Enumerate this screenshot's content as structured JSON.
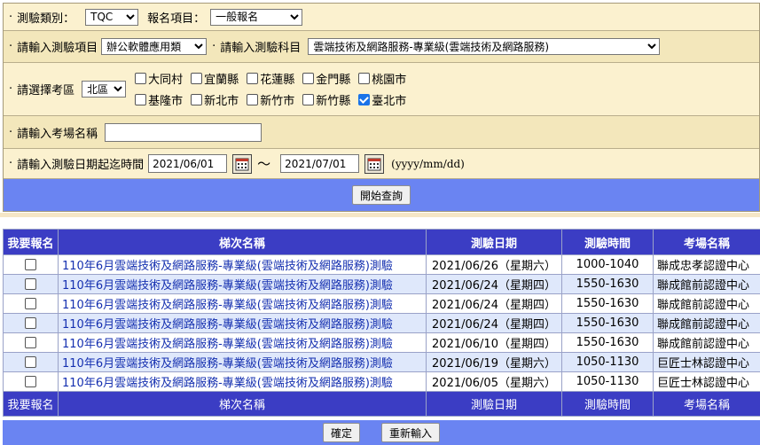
{
  "form": {
    "category_label": "測驗類別：",
    "category_value": "TQC",
    "reg_item_label": "報名項目：",
    "reg_item_value": "一般報名",
    "test_item_label": "請輸入測驗項目",
    "test_item_value": "辦公軟體應用類",
    "subject_label": "請輸入測驗科目",
    "subject_value": "雲端技術及網路服務-專業級(雲端技術及網路服務)",
    "area_label": "請選擇考區",
    "area_value": "北區",
    "areas_row1": [
      {
        "label": "大同村",
        "checked": false
      },
      {
        "label": "宜蘭縣",
        "checked": false
      },
      {
        "label": "花蓮縣",
        "checked": false
      },
      {
        "label": "金門縣",
        "checked": false
      },
      {
        "label": "桃園市",
        "checked": false
      }
    ],
    "areas_row2": [
      {
        "label": "基隆市",
        "checked": false
      },
      {
        "label": "新北市",
        "checked": false
      },
      {
        "label": "新竹市",
        "checked": false
      },
      {
        "label": "新竹縣",
        "checked": false
      },
      {
        "label": "臺北市",
        "checked": true
      }
    ],
    "venue_label": "請輸入考場名稱",
    "venue_value": "",
    "date_label": "請輸入測驗日期起迄時間",
    "date_from": "2021/06/01",
    "date_tilde": "～",
    "date_to": "2021/07/01",
    "date_format": "(yyyy/mm/dd)",
    "search_button": "開始查詢"
  },
  "table": {
    "headers": [
      "我要報名",
      "梯次名稱",
      "測驗日期",
      "測驗時間",
      "考場名稱"
    ],
    "rows": [
      {
        "checked": false,
        "name": "110年6月雲端技術及網路服務-專業級(雲端技術及網路服務)測驗",
        "date": "2021/06/26（星期六）",
        "time": "1000-1040",
        "venue": "聯成忠孝認證中心"
      },
      {
        "checked": false,
        "name": "110年6月雲端技術及網路服務-專業級(雲端技術及網路服務)測驗",
        "date": "2021/06/24（星期四）",
        "time": "1550-1630",
        "venue": "聯成館前認證中心"
      },
      {
        "checked": false,
        "name": "110年6月雲端技術及網路服務-專業級(雲端技術及網路服務)測驗",
        "date": "2021/06/24（星期四）",
        "time": "1550-1630",
        "venue": "聯成館前認證中心"
      },
      {
        "checked": false,
        "name": "110年6月雲端技術及網路服務-專業級(雲端技術及網路服務)測驗",
        "date": "2021/06/24（星期四）",
        "time": "1550-1630",
        "venue": "聯成館前認證中心"
      },
      {
        "checked": false,
        "name": "110年6月雲端技術及網路服務-專業級(雲端技術及網路服務)測驗",
        "date": "2021/06/10（星期四）",
        "time": "1550-1630",
        "venue": "聯成館前認證中心"
      },
      {
        "checked": false,
        "name": "110年6月雲端技術及網路服務-專業級(雲端技術及網路服務)測驗",
        "date": "2021/06/19（星期六）",
        "time": "1050-1130",
        "venue": "巨匠士林認證中心"
      },
      {
        "checked": false,
        "name": "110年6月雲端技術及網路服務-專業級(雲端技術及網路服務)測驗",
        "date": "2021/06/05（星期六）",
        "time": "1050-1130",
        "venue": "巨匠士林認證中心"
      }
    ]
  },
  "actions": {
    "confirm": "確定",
    "reset": "重新輸入"
  },
  "colors": {
    "form_bg": "#fbf1cf",
    "header_blue": "#3b3dc4",
    "bar_blue": "#6a84f2",
    "row_alt": "#dfe8fb",
    "link_blue": "#1530b0"
  },
  "icons": {
    "calendar": "calendar-icon",
    "checkbox": "checkbox-icon"
  }
}
